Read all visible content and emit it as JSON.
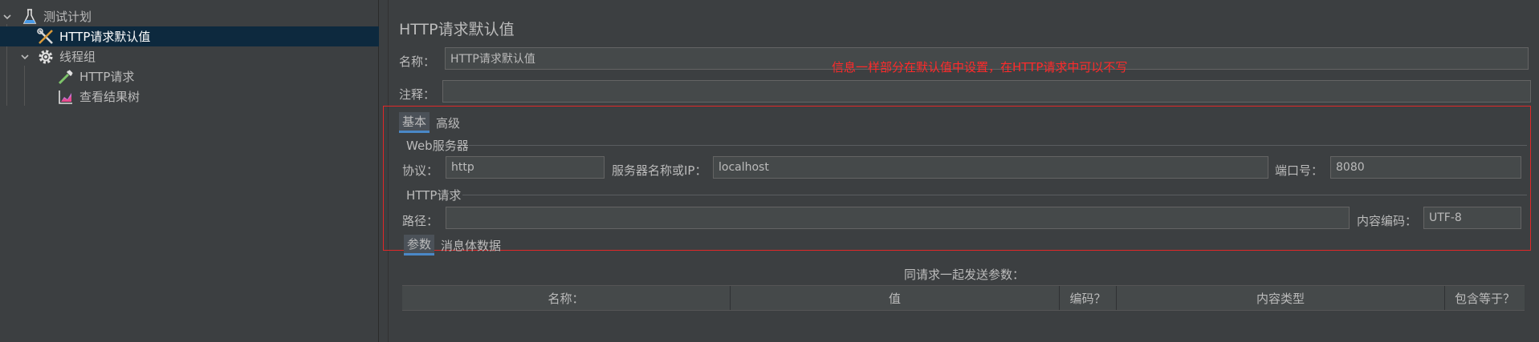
{
  "tree": {
    "items": [
      {
        "label": "测试计划",
        "icon": "flask-icon"
      },
      {
        "label": "HTTP请求默认值",
        "icon": "wrench-icon"
      },
      {
        "label": "线程组",
        "icon": "gear-icon"
      },
      {
        "label": "HTTP请求",
        "icon": "pipette-icon"
      },
      {
        "label": "查看结果树",
        "icon": "chart-icon"
      }
    ]
  },
  "panel": {
    "title": "HTTP请求默认值",
    "name_label": "名称：",
    "name_value": "HTTP请求默认值",
    "comment_label": "注释：",
    "comment_value": "",
    "annotation": "信息一样部分在默认值中设置，在HTTP请求中可以不写",
    "tabs": {
      "basic": "基本",
      "advanced": "高级"
    },
    "web_server": {
      "section": "Web服务器",
      "protocol_label": "协议：",
      "protocol_value": "http",
      "server_label": "服务器名称或IP：",
      "server_value": "localhost",
      "port_label": "端口号：",
      "port_value": "8080"
    },
    "http_request": {
      "section": "HTTP请求",
      "path_label": "路径：",
      "path_value": "",
      "encoding_label": "内容编码：",
      "encoding_value": "UTF-8"
    },
    "sub_tabs": {
      "params": "参数",
      "body": "消息体数据"
    },
    "params_caption": "同请求一起发送参数：",
    "table_headers": [
      "名称：",
      "值",
      "编码？",
      "内容类型",
      "包含等于？"
    ]
  },
  "colors": {
    "background": "#3c3f41",
    "selected_row": "#0d293e",
    "annotation_red": "#ff2a2a",
    "tab_underline": "#4a88c7"
  }
}
